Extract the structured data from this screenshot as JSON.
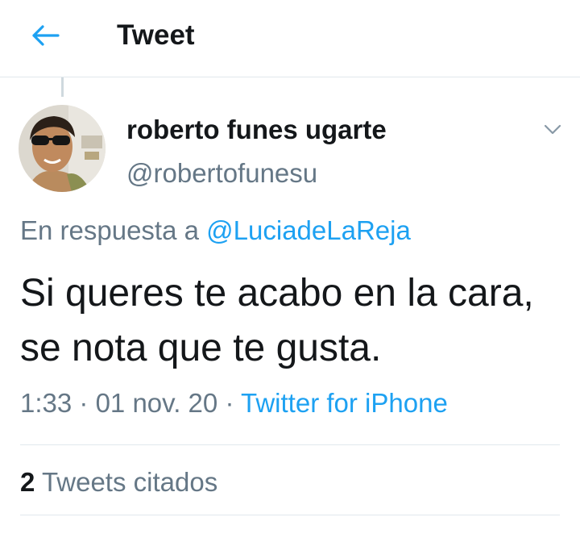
{
  "header": {
    "title": "Tweet",
    "back_icon": "back-arrow-icon",
    "accent": "#1da1f2"
  },
  "tweet": {
    "author_name": "roberto funes ugarte",
    "author_handle": "@robertofunesu",
    "reply_prefix": "En respuesta a",
    "reply_to": "@LuciadeLaReja",
    "text": "Si queres te acabo en la cara, se nota que te gusta.",
    "time": "1:33",
    "separator": "·",
    "date": "01 nov. 20",
    "source": "Twitter for iPhone",
    "caret_icon": "chevron-down-icon"
  },
  "stats": {
    "quote_count": "2",
    "quote_label": "Tweets citados"
  },
  "colors": {
    "text": "#14171a",
    "secondary": "#657786",
    "link": "#1da1f2",
    "divider": "#e1e8ed"
  }
}
